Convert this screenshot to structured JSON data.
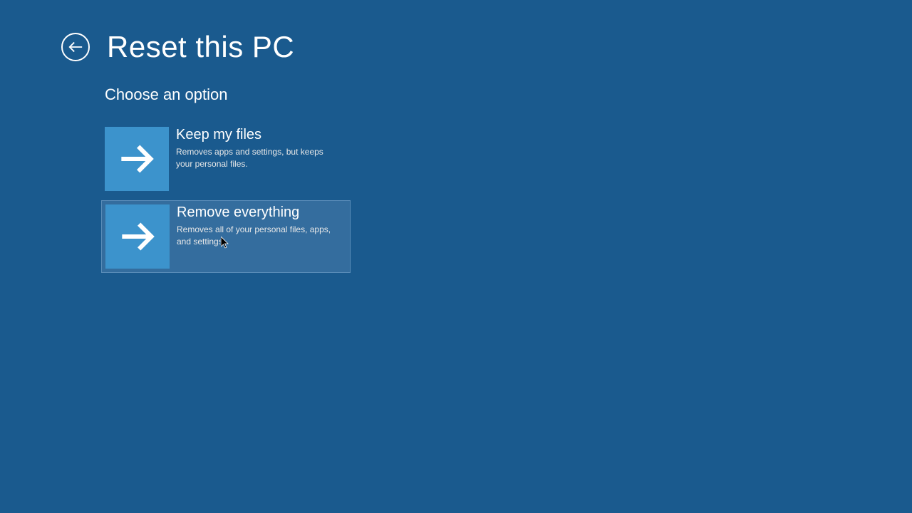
{
  "header": {
    "title": "Reset this PC"
  },
  "content": {
    "subtitle": "Choose an option"
  },
  "options": [
    {
      "title": "Keep my files",
      "description": "Removes apps and settings, but keeps your personal files."
    },
    {
      "title": "Remove everything",
      "description": "Removes all of your personal files, apps, and settings."
    }
  ]
}
